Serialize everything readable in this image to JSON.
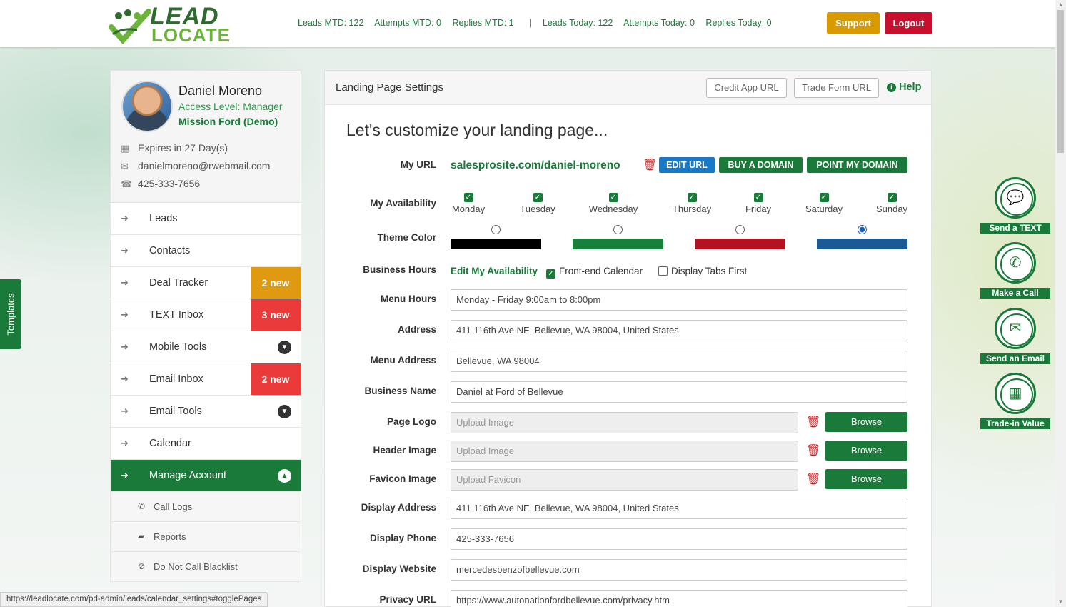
{
  "header": {
    "logo_line1": "LEAD",
    "logo_line2": "LOCATE",
    "stats": {
      "leads_mtd": "Leads MTD: 122",
      "attempts_mtd": "Attempts MTD: 0",
      "replies_mtd": "Replies MTD: 1",
      "separator": "|",
      "leads_today": "Leads Today: 122",
      "attempts_today": "Attempts Today: 0",
      "replies_today": "Replies Today: 0"
    },
    "support_label": "Support",
    "logout_label": "Logout"
  },
  "templates_tab": "Templates",
  "profile": {
    "name": "Daniel Moreno",
    "access_level": "Access Level: Manager",
    "dealer": "Mission Ford (Demo)",
    "expires": "Expires in 27 Day(s)",
    "email": "danielmoreno@rwebmail.com",
    "phone": "425-333-7656"
  },
  "menu": {
    "leads": "Leads",
    "contacts": "Contacts",
    "deal_tracker": "Deal Tracker",
    "deal_tracker_badge": "2 new",
    "text_inbox": "TEXT Inbox",
    "text_inbox_badge": "3 new",
    "mobile_tools": "Mobile Tools",
    "email_inbox": "Email Inbox",
    "email_inbox_badge": "2 new",
    "email_tools": "Email Tools",
    "calendar": "Calendar",
    "manage_account": "Manage Account",
    "sub": {
      "call_logs": "Call Logs",
      "reports": "Reports",
      "do_not_call": "Do Not Call Blacklist"
    }
  },
  "status_url": "https://leadlocate.com/pd-admin/leads/calendar_settings#togglePages",
  "panel": {
    "title": "Landing Page Settings",
    "credit_app_label": "Credit App URL",
    "trade_form_label": "Trade Form URL",
    "help_label": "Help",
    "heading": "Let's customize your landing page...",
    "labels": {
      "my_url": "My URL",
      "availability": "My Availability",
      "theme_color": "Theme Color",
      "business_hours": "Business Hours",
      "menu_hours": "Menu Hours",
      "address": "Address",
      "menu_address": "Menu Address",
      "business_name": "Business Name",
      "page_logo": "Page Logo",
      "header_image": "Header Image",
      "favicon_image": "Favicon Image",
      "display_address": "Display Address",
      "display_phone": "Display Phone",
      "display_website": "Display Website",
      "privacy_url": "Privacy URL"
    },
    "my_url_value": "salesprosite.com/daniel-moreno",
    "edit_url_label": "EDIT URL",
    "buy_domain_label": "BUY A DOMAIN",
    "point_domain_label": "POINT MY DOMAIN",
    "days": [
      "Monday",
      "Tuesday",
      "Wednesday",
      "Thursday",
      "Friday",
      "Saturday",
      "Sunday"
    ],
    "days_checked": [
      true,
      true,
      true,
      true,
      true,
      true,
      true
    ],
    "theme_colors": [
      "#000000",
      "#17803a",
      "#b3121f",
      "#1b5a94"
    ],
    "theme_selected_index": 3,
    "edit_availability_label": "Edit My Availability",
    "frontend_calendar_label": "Front-end Calendar",
    "frontend_calendar_checked": true,
    "display_tabs_first_label": "Display Tabs First",
    "display_tabs_first_checked": false,
    "menu_hours_value": "Monday - Friday 9:00am to 8:00pm",
    "address_value": "411 116th Ave NE, Bellevue, WA 98004, United States",
    "menu_address_value": "Bellevue, WA 98004",
    "business_name_value": "Daniel at Ford of Bellevue",
    "page_logo_placeholder": "Upload Image",
    "header_image_placeholder": "Upload Image",
    "favicon_placeholder": "Upload Favicon",
    "browse_label": "Browse",
    "display_address_value": "411 116th Ave NE, Bellevue, WA 98004, United States",
    "display_phone_value": "425-333-7656",
    "display_website_value": "mercedesbenzofbellevue.com",
    "privacy_url_value": "https://www.autonationfordbellevue.com/privacy.htm"
  },
  "actions": {
    "send_text": "Send a TEXT",
    "make_call": "Make a Call",
    "send_email": "Send an Email",
    "trade_in": "Trade-in Value"
  },
  "colors": {
    "brand_green": "#1a7a3a",
    "accent_orange": "#e09a12",
    "alert_red": "#ea3a3a",
    "link_blue": "#1a78c8"
  }
}
